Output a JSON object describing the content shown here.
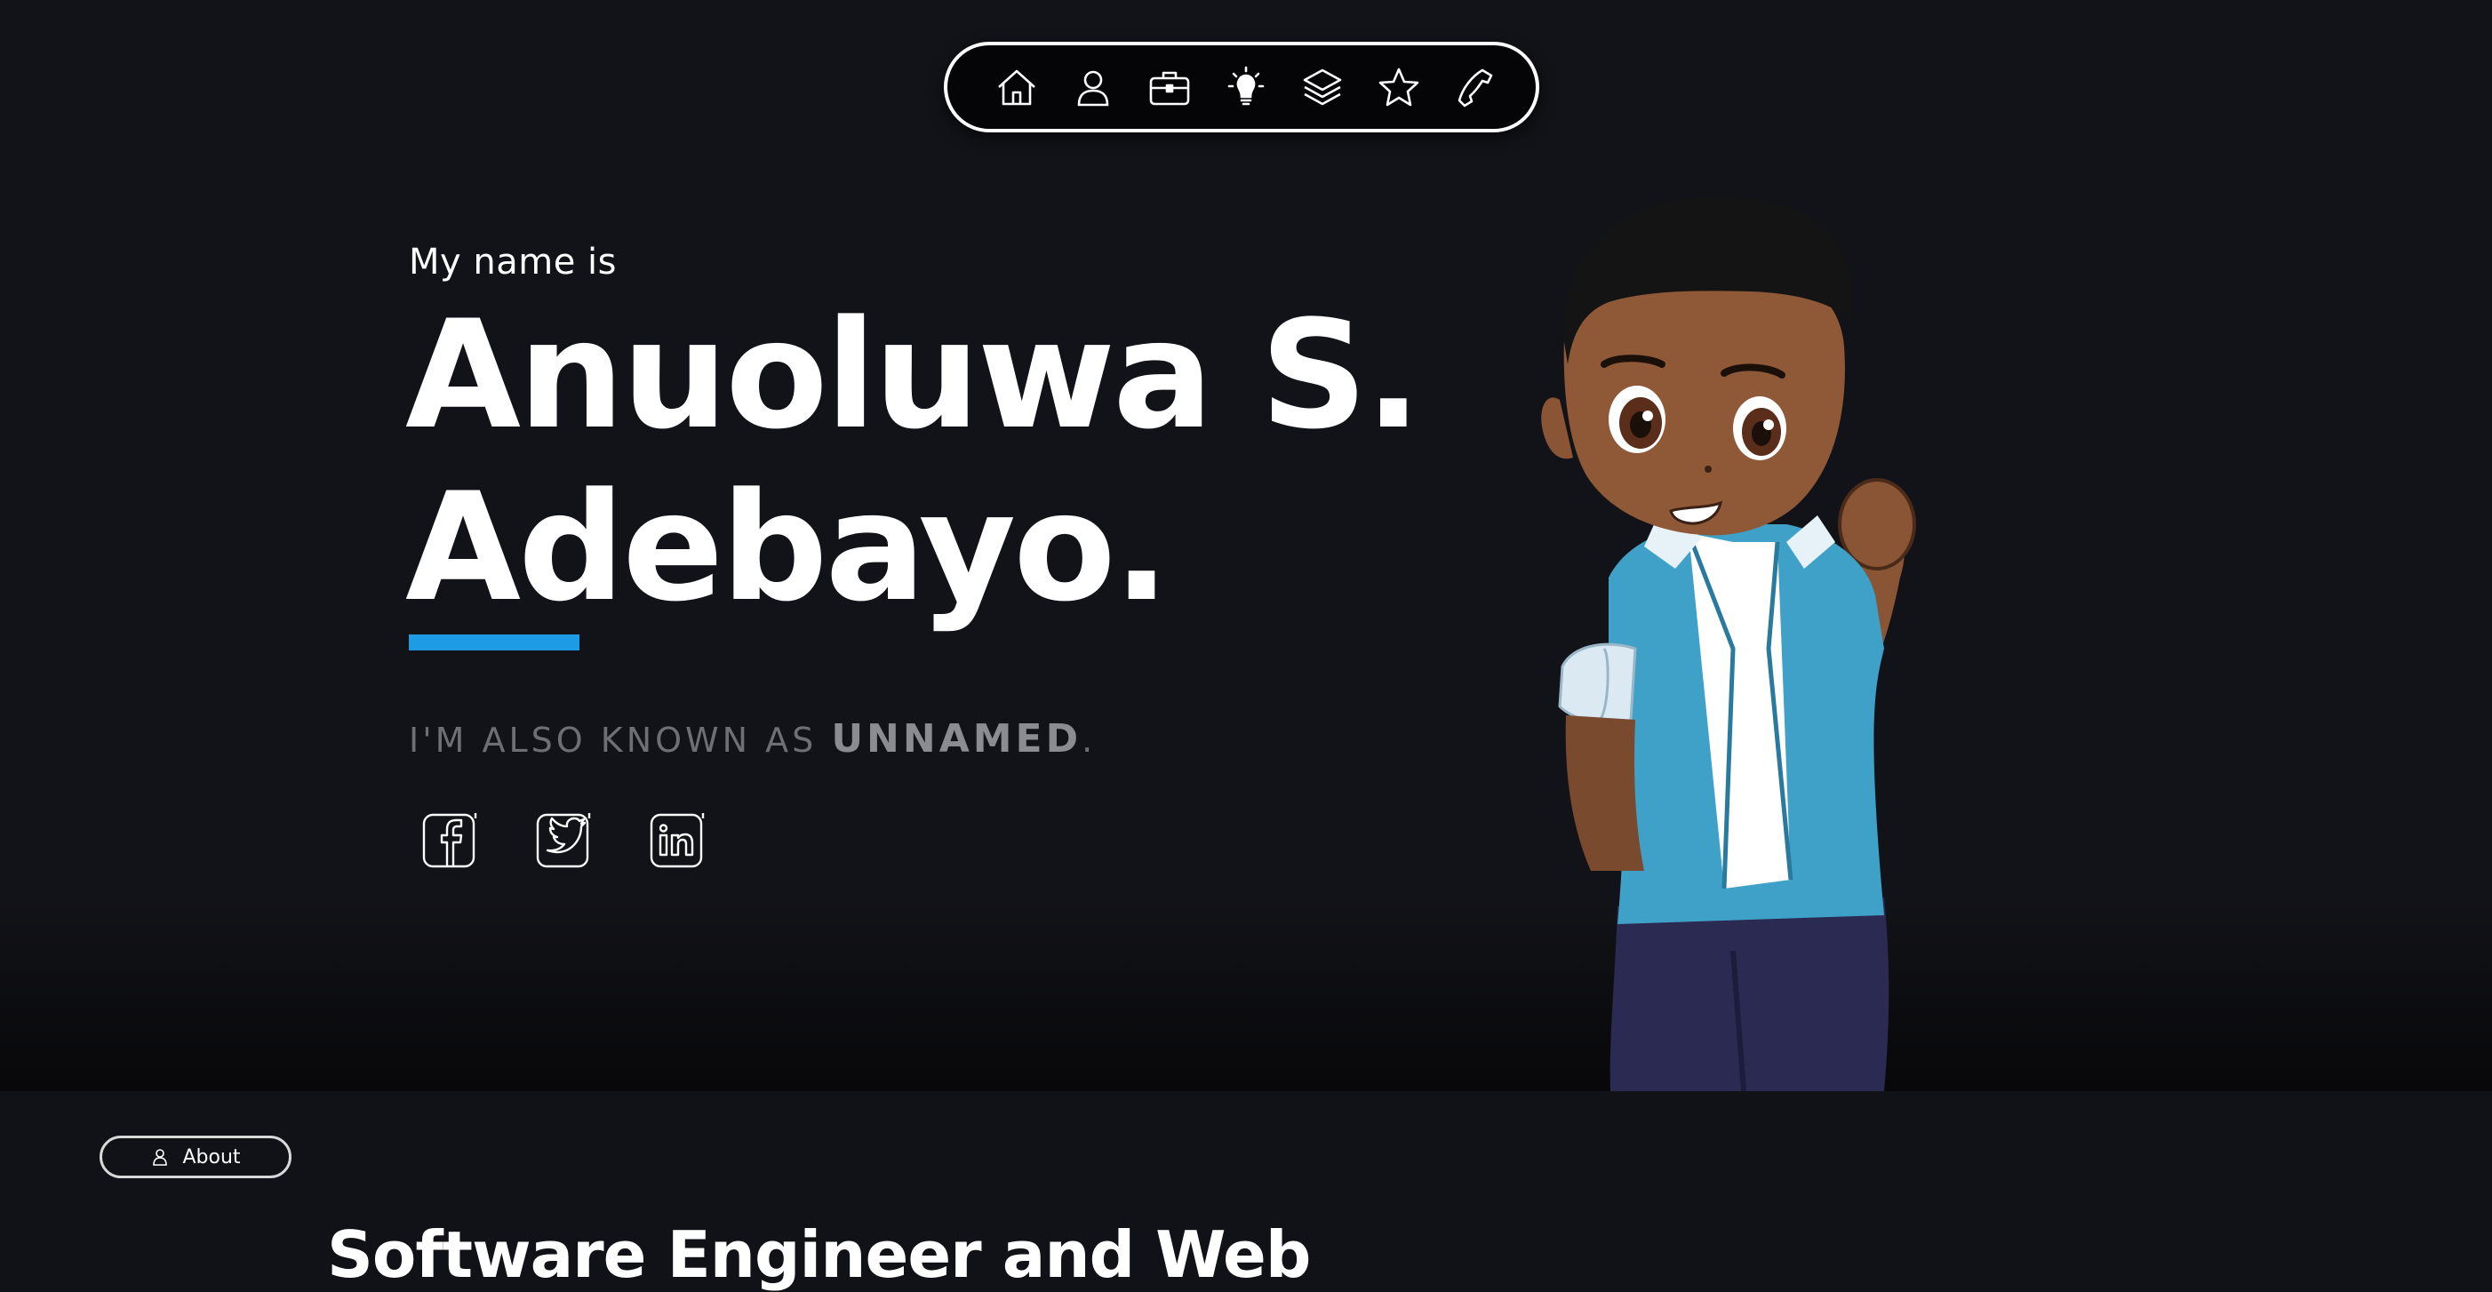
{
  "nav": {
    "items": [
      {
        "icon": "home-icon"
      },
      {
        "icon": "user-icon"
      },
      {
        "icon": "briefcase-icon"
      },
      {
        "icon": "lightbulb-icon"
      },
      {
        "icon": "layers-icon"
      },
      {
        "icon": "star-icon"
      },
      {
        "icon": "phone-icon"
      }
    ]
  },
  "hero": {
    "intro": "My name is",
    "name_line1": "Anuoluwa S.",
    "name_line2": "Adebayo.",
    "aka_prefix": "I'M ALSO KNOWN AS ",
    "aka_name": "UNNAMED",
    "aka_suffix": ".",
    "accent_color": "#1e9be5",
    "socials": [
      {
        "icon": "facebook-icon"
      },
      {
        "icon": "twitter-icon"
      },
      {
        "icon": "linkedin-icon"
      }
    ]
  },
  "about": {
    "pill_label": "About",
    "heading": "Software Engineer and Web"
  },
  "colors": {
    "background": "#111217",
    "text": "#ffffff",
    "muted": "#6d6f75"
  }
}
